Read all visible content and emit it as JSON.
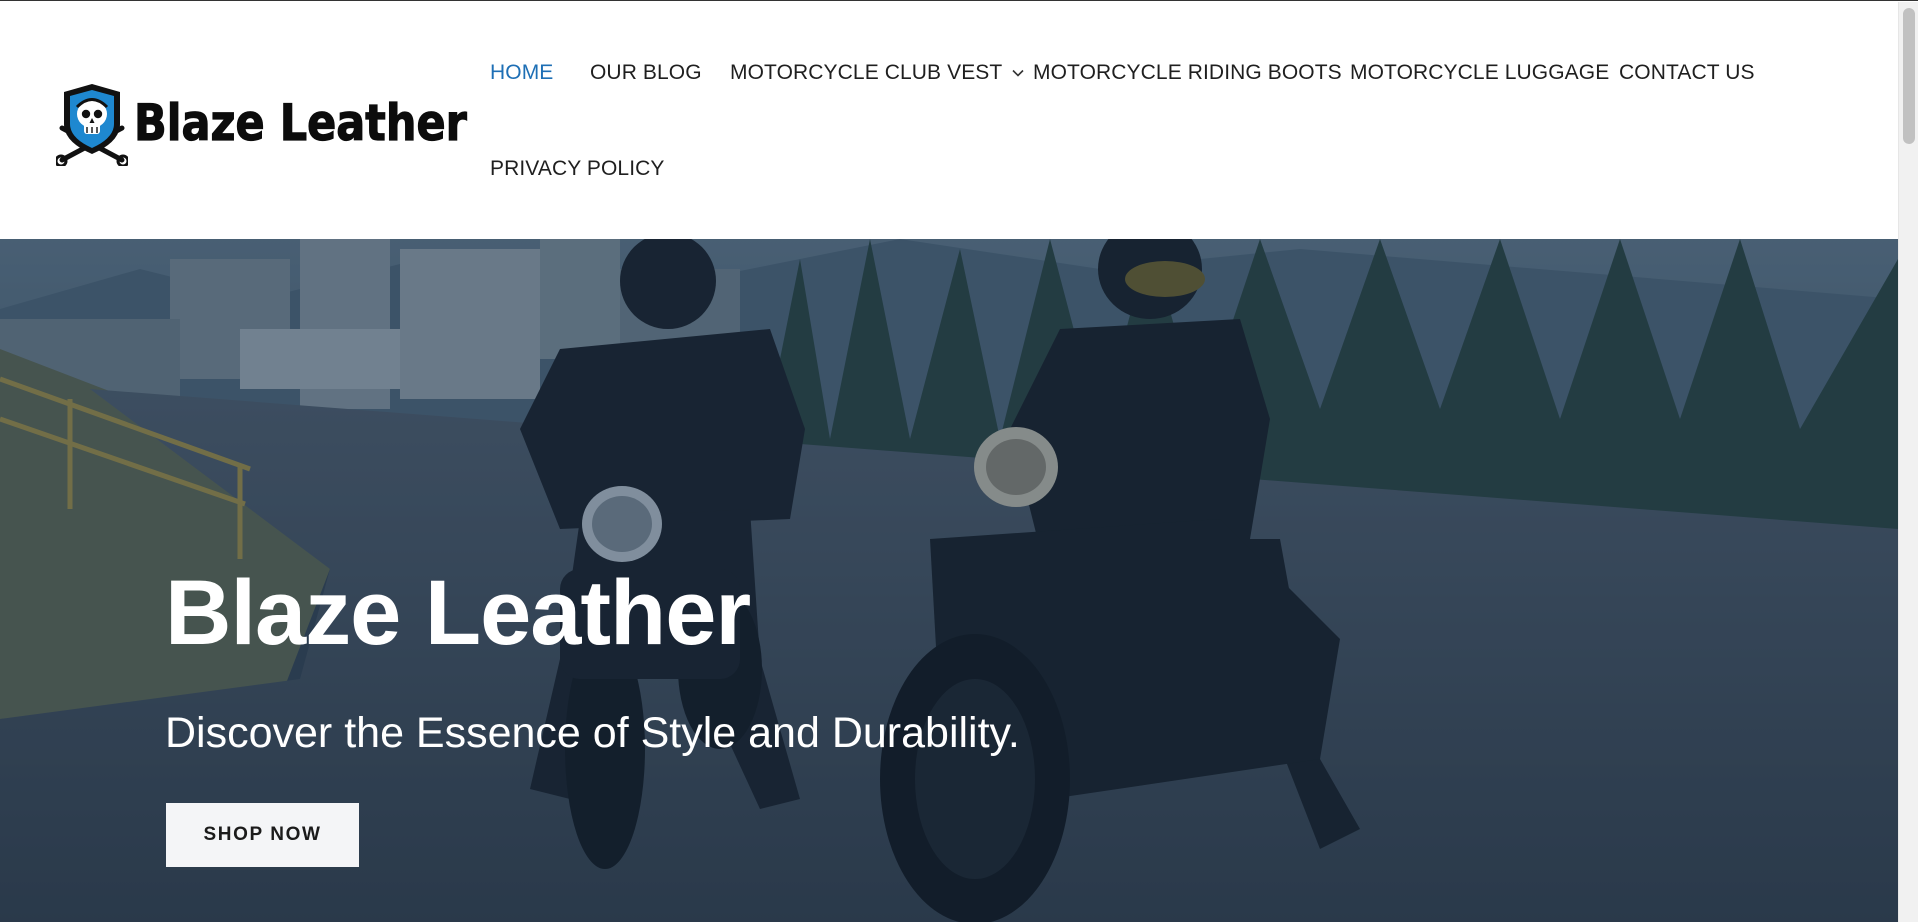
{
  "brand": {
    "name": "Blaze Leather",
    "emblem_icon": "skull-shield-wrenches-icon",
    "emblem_color": "#1e88d0"
  },
  "nav": {
    "items": [
      {
        "label": "HOME",
        "active": true
      },
      {
        "label": "OUR BLOG",
        "active": false
      },
      {
        "label": "MOTORCYCLE CLUB VEST",
        "active": false,
        "has_dropdown": true
      },
      {
        "label": "MOTORCYCLE RIDING BOOTS",
        "active": false
      },
      {
        "label": "MOTORCYCLE LUGGAGE",
        "active": false
      },
      {
        "label": "CONTACT US",
        "active": false
      },
      {
        "label": "PRIVACY POLICY",
        "active": false
      }
    ],
    "dropdown_icon": "chevron-down-icon"
  },
  "hero": {
    "title": "Blaze Leather",
    "subtitle": "Discover the Essence of Style and Durability.",
    "cta_label": "SHOP NOW"
  },
  "colors": {
    "accent": "#1e6fb5",
    "nav_text": "#1f1f1f",
    "hero_overlay": "#122842"
  }
}
